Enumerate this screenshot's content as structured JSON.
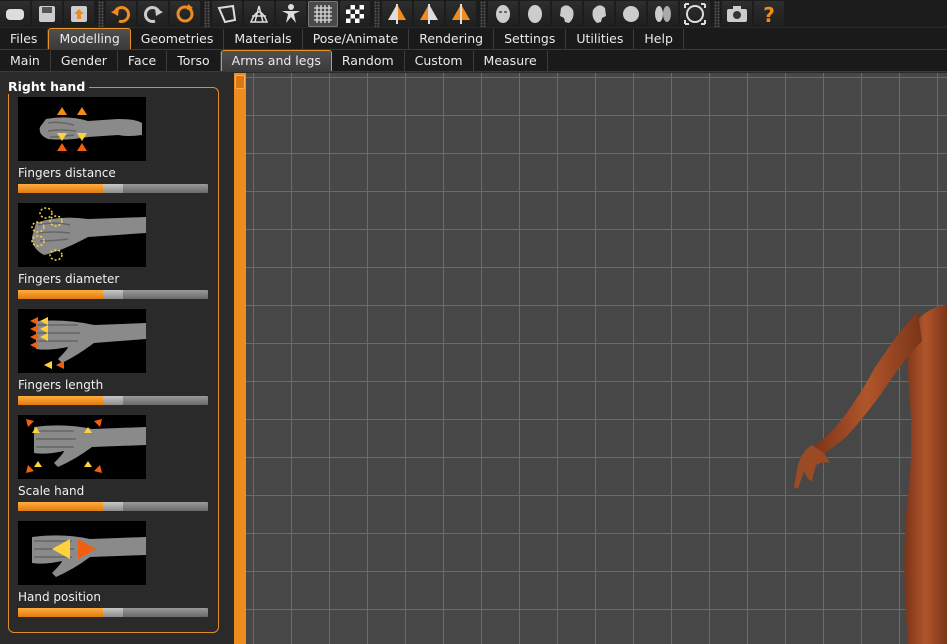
{
  "toolbar": {
    "buttons": [
      {
        "icon": "new-file-icon"
      },
      {
        "icon": "save-icon"
      },
      {
        "icon": "export-icon"
      },
      {
        "icon": "undo-icon"
      },
      {
        "icon": "redo-icon"
      },
      {
        "icon": "reset-icon"
      },
      {
        "icon": "smooth-icon"
      },
      {
        "icon": "wireframe-icon"
      },
      {
        "icon": "pose-icon"
      },
      {
        "icon": "grid-icon"
      },
      {
        "icon": "checker-icon"
      },
      {
        "icon": "symmetry-right-icon"
      },
      {
        "icon": "symmetry-left-icon"
      },
      {
        "icon": "symmetry-icon"
      },
      {
        "icon": "front-view-icon"
      },
      {
        "icon": "back-view-icon"
      },
      {
        "icon": "left-view-icon"
      },
      {
        "icon": "right-view-icon"
      },
      {
        "icon": "top-view-icon"
      },
      {
        "icon": "bottom-view-icon"
      },
      {
        "icon": "reset-camera-icon"
      },
      {
        "icon": "screenshot-icon"
      },
      {
        "icon": "help-icon"
      }
    ]
  },
  "main_tabs": [
    "Files",
    "Modelling",
    "Geometries",
    "Materials",
    "Pose/Animate",
    "Rendering",
    "Settings",
    "Utilities",
    "Help"
  ],
  "main_tab_selected": "Modelling",
  "sub_tabs": [
    "Main",
    "Gender",
    "Face",
    "Torso",
    "Arms and legs",
    "Random",
    "Custom",
    "Measure"
  ],
  "sub_tab_selected": "Arms and legs",
  "panel": {
    "title": "Right hand",
    "items": [
      {
        "label": "Fingers distance",
        "value": 0.5
      },
      {
        "label": "Fingers diameter",
        "value": 0.5
      },
      {
        "label": "Fingers length",
        "value": 0.5
      },
      {
        "label": "Scale hand",
        "value": 0.5
      },
      {
        "label": "Hand position",
        "value": 0.5
      }
    ]
  },
  "colors": {
    "accent": "#f08c1c",
    "skin": "#a04a22"
  }
}
